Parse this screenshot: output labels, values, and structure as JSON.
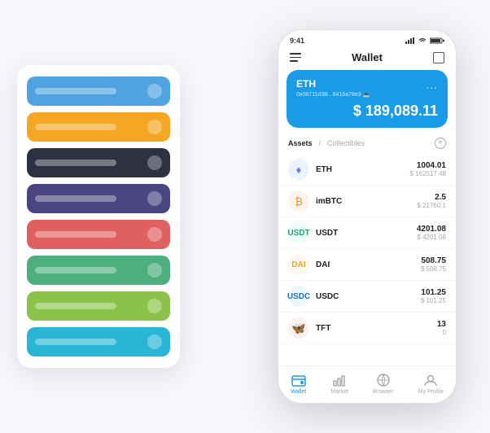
{
  "scene": {
    "background": "#f5f7fa"
  },
  "left_panel": {
    "cards": [
      {
        "color": "card-blue",
        "icon": "💎"
      },
      {
        "color": "card-orange",
        "icon": "🔶"
      },
      {
        "color": "card-dark",
        "icon": "⚙️"
      },
      {
        "color": "card-purple",
        "icon": "🔮"
      },
      {
        "color": "card-red",
        "icon": "❤️"
      },
      {
        "color": "card-green",
        "icon": "💚"
      },
      {
        "color": "card-light-green",
        "icon": "🌿"
      },
      {
        "color": "card-teal",
        "icon": "💠"
      }
    ]
  },
  "phone": {
    "status_bar": {
      "time": "9:41",
      "wifi": true,
      "battery": true
    },
    "header": {
      "title": "Wallet"
    },
    "eth_card": {
      "symbol": "ETH",
      "address": "0x08711d3B...8416a78e3  💻",
      "balance": "$ 189,089.11",
      "menu_dots": "..."
    },
    "assets_section": {
      "tab_assets": "Assets",
      "divider": "/",
      "tab_collectibles": "Collectibles",
      "add_button": "+"
    },
    "assets": [
      {
        "symbol": "ETH",
        "icon": "♦",
        "icon_class": "icon-eth",
        "amount": "1004.01",
        "usd": "$ 162517.48"
      },
      {
        "symbol": "imBTC",
        "icon": "₿",
        "icon_class": "icon-imbtc",
        "amount": "2.5",
        "usd": "$ 21760.1"
      },
      {
        "symbol": "USDT",
        "icon": "₮",
        "icon_class": "icon-usdt",
        "amount": "4201.08",
        "usd": "$ 4201.08"
      },
      {
        "symbol": "DAI",
        "icon": "◈",
        "icon_class": "icon-dai",
        "amount": "508.75",
        "usd": "$ 508.75"
      },
      {
        "symbol": "USDC",
        "icon": "$",
        "icon_class": "icon-usdc",
        "amount": "101.25",
        "usd": "$ 101.25"
      },
      {
        "symbol": "TFT",
        "icon": "🦋",
        "icon_class": "icon-tft",
        "amount": "13",
        "usd": "0"
      }
    ],
    "nav": [
      {
        "label": "Wallet",
        "active": true
      },
      {
        "label": "Market",
        "active": false
      },
      {
        "label": "Browser",
        "active": false
      },
      {
        "label": "My Profile",
        "active": false
      }
    ]
  }
}
